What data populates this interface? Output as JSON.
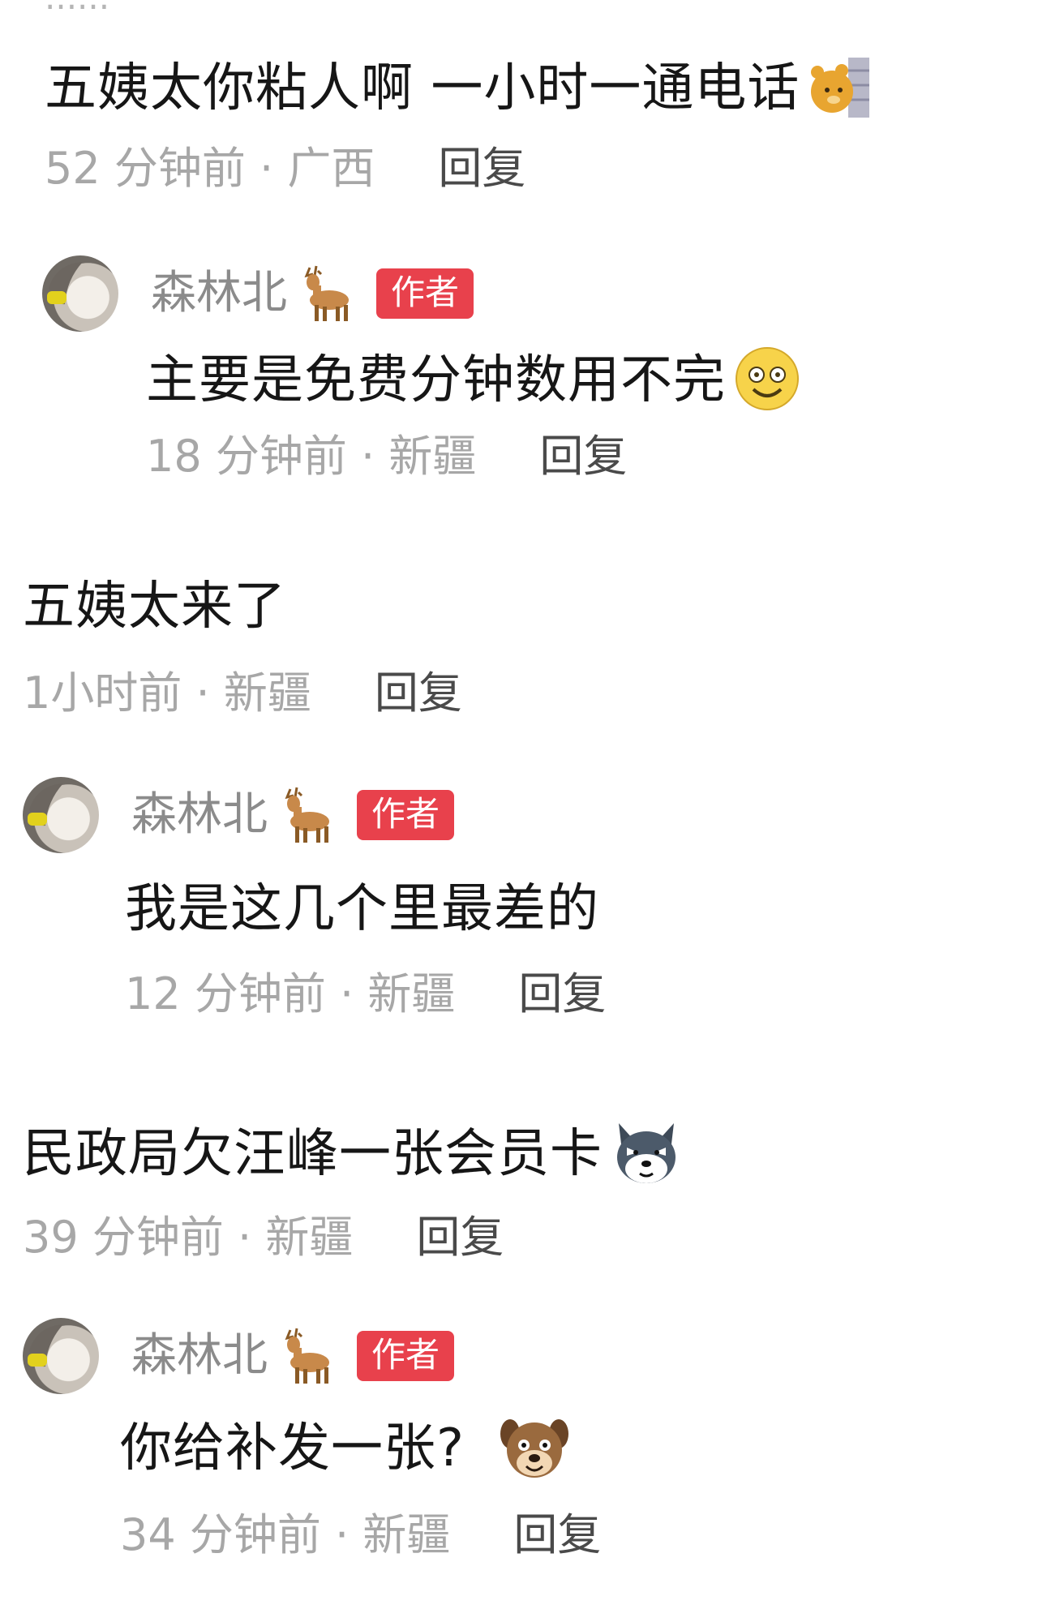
{
  "comments": [
    {
      "text": "五姨太你粘人啊 一小时一通电话",
      "emoji": "bear-peek-icon",
      "time": "52 分钟前 · 广西",
      "reply": "回复"
    },
    {
      "author": "森林北",
      "author_emoji": "deer-icon",
      "badge": "作者",
      "text": "主要是免费分钟数用不完",
      "emoji": "smile-face-icon",
      "time": "18 分钟前 · 新疆",
      "reply": "回复"
    },
    {
      "text": "五姨太来了",
      "time": "1小时前 · 新疆",
      "reply": "回复"
    },
    {
      "author": "森林北",
      "author_emoji": "deer-icon",
      "badge": "作者",
      "text": "我是这几个里最差的",
      "time": "12 分钟前 · 新疆",
      "reply": "回复"
    },
    {
      "text": "民政局欠汪峰一张会员卡",
      "emoji": "husky-icon",
      "time": "39 分钟前 · 新疆",
      "reply": "回复"
    },
    {
      "author": "森林北",
      "author_emoji": "deer-icon",
      "badge": "作者",
      "text": "你给补发一张?",
      "emoji": "dog-face-icon",
      "time": "34 分钟前 · 新疆",
      "reply": "回复"
    }
  ],
  "colors": {
    "badge": "#e8414c",
    "meta": "#a7a7a7",
    "reply": "#4a4a4a"
  }
}
